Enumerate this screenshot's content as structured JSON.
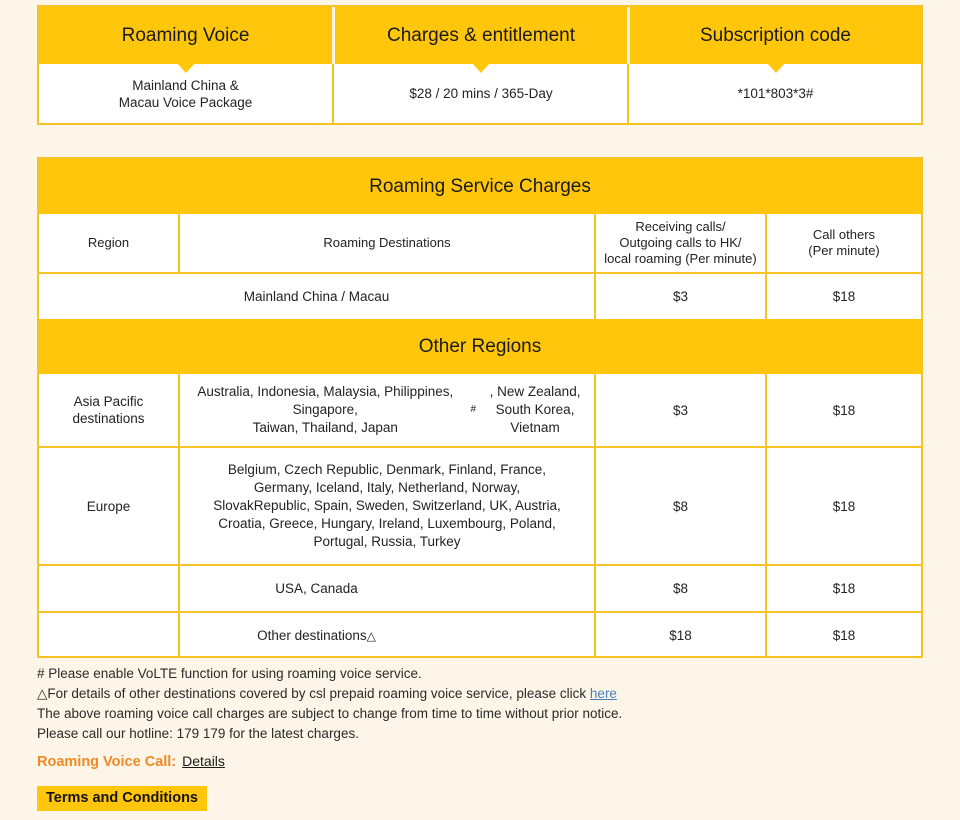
{
  "package_table": {
    "headers": [
      "Roaming Voice",
      "Charges & entitlement",
      "Subscription code"
    ],
    "row": [
      "Mainland China &\nMacau Voice Package",
      "$28 / 20 mins / 365-Day",
      "*101*803*3#"
    ]
  },
  "charges_table": {
    "title": "Roaming Service Charges",
    "columns": [
      "Region",
      "Roaming Destinations",
      "Receiving calls/\nOutgoing calls to HK/\nlocal roaming (Per minute)",
      "Call others\n(Per minute)"
    ],
    "primary_row": {
      "destinations": "Mainland China / Macau",
      "receiving": "$3",
      "call_others": "$18"
    },
    "other_regions_title": "Other Regions",
    "rows": [
      {
        "region": "Asia Pacific\ndestinations",
        "destinations": "Australia, Indonesia, Malaysia, Philippines, Singapore,\nTaiwan, Thailand, Japan#, New Zealand,\nSouth Korea, Vietnam",
        "receiving": "$3",
        "call_others": "$18"
      },
      {
        "region": "Europe",
        "destinations": "Belgium, Czech Republic, Denmark, Finland, France,\nGermany, Iceland, Italy, Netherland, Norway,\nSlovakRepublic, Spain, Sweden, Switzerland, UK, Austria,\nCroatia, Greece, Hungary, Ireland, Luxembourg, Poland,\nPortugal, Russia, Turkey",
        "receiving": "$8",
        "call_others": "$18"
      },
      {
        "region": "",
        "destinations": "USA, Canada",
        "receiving": "$8",
        "call_others": "$18"
      },
      {
        "region": "",
        "destinations": "Other destinations",
        "destinations_mark": "△",
        "receiving": "$18",
        "call_others": "$18"
      }
    ]
  },
  "footnotes": {
    "volte": "# Please enable VoLTE function for using roaming voice service.",
    "other_dest_prefix": "△For details of other destinations covered by csl prepaid roaming voice service, please click",
    "other_dest_link": "here",
    "subject_to_change": "The above roaming voice call charges are subject to change from time to time without prior notice.",
    "hotline": "Please call our hotline: 179 179 for the latest charges.",
    "roaming_voice_call_label": "Roaming Voice Call:",
    "details_link": "Details"
  },
  "terms_button": "Terms and Conditions",
  "colors": {
    "brand_yellow": "#FFC60B",
    "border_gold": "#F6C324",
    "page_bg": "#FDF5E7",
    "accent_orange": "#F08A24",
    "link_blue": "#4A7EBB"
  }
}
